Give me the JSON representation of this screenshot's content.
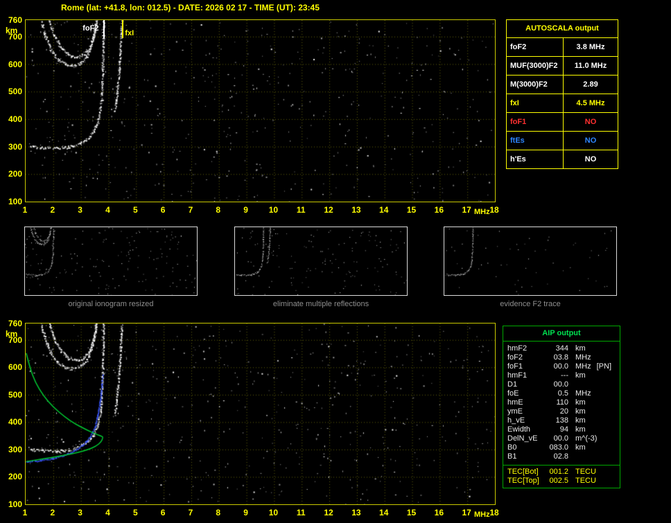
{
  "header": {
    "title": "Rome (lat: +41.8, lon: 012.5) - DATE: 2026 02 17 - TIME (UT): 23:45"
  },
  "autoscala_table": {
    "title": "AUTOSCALA output",
    "border_color": "#ffff00",
    "rows": [
      {
        "label": "foF2",
        "value": "3.8 MHz",
        "color": "#ffffff"
      },
      {
        "label": "MUF(3000)F2",
        "value": "11.0 MHz",
        "color": "#ffffff"
      },
      {
        "label": "M(3000)F2",
        "value": "2.89",
        "color": "#ffffff"
      },
      {
        "label": "fxI",
        "value": "4.5 MHz",
        "color": "#ffff00"
      },
      {
        "label": "foF1",
        "value": "NO",
        "color": "#ff3030"
      },
      {
        "label": "ftEs",
        "value": "NO",
        "color": "#2e86ff"
      },
      {
        "label": "h'Es",
        "value": "NO",
        "color": "#ffffff"
      }
    ]
  },
  "aip_table": {
    "title": "AIP output",
    "border_color": "#00a800",
    "title_color": "#00e050",
    "text_color": "#eaeaea",
    "tec_color": "#ffff00",
    "rows": [
      {
        "label": "hmF2",
        "value": "344",
        "unit": "km",
        "note": ""
      },
      {
        "label": "foF2",
        "value": "03.8",
        "unit": "MHz",
        "note": ""
      },
      {
        "label": "foF1",
        "value": "00.0",
        "unit": "MHz",
        "note": "[PN]"
      },
      {
        "label": "hmF1",
        "value": "---",
        "unit": "km",
        "note": ""
      },
      {
        "label": "D1",
        "value": "00.0",
        "unit": "",
        "note": ""
      },
      {
        "label": "foE",
        "value": "0.5",
        "unit": "MHz",
        "note": ""
      },
      {
        "label": "hmE",
        "value": "110",
        "unit": "km",
        "note": ""
      },
      {
        "label": "ymE",
        "value": "20",
        "unit": "km",
        "note": ""
      },
      {
        "label": "h_vE",
        "value": "138",
        "unit": "km",
        "note": ""
      },
      {
        "label": "Ewidth",
        "value": "94",
        "unit": "km",
        "note": ""
      },
      {
        "label": "DelN_vE",
        "value": "00.0",
        "unit": "m^(-3)",
        "note": ""
      },
      {
        "label": "B0",
        "value": "083.0",
        "unit": "km",
        "note": ""
      },
      {
        "label": "B1",
        "value": "02.8",
        "unit": "",
        "note": ""
      }
    ],
    "tec_rows": [
      {
        "label": "TEC[Bot]",
        "value": "001.2",
        "unit": "TECU"
      },
      {
        "label": "TEC[Top]",
        "value": "002.5",
        "unit": "TECU"
      }
    ]
  },
  "thumbnails": [
    {
      "caption": "original ionogram resized",
      "series_ids": [
        "f2_2hop",
        "f2_2hop_x",
        "f2_o"
      ],
      "noise_points": 180
    },
    {
      "caption": "eliminate multiple reflections",
      "series_ids": [
        "f2_o",
        "f2_x"
      ],
      "noise_points": 150
    },
    {
      "caption": "evidence F2 trace",
      "series_ids": [
        "f2_o"
      ],
      "noise_points": 55
    }
  ],
  "chart_data": [
    {
      "id": "autoscala_ionogram",
      "type": "scatter",
      "xlabel": "MHz",
      "ylabel": "km",
      "xlim": [
        1,
        18
      ],
      "ylim": [
        100,
        760
      ],
      "x_ticks": [
        1,
        2,
        3,
        4,
        5,
        6,
        7,
        8,
        9,
        10,
        11,
        12,
        13,
        14,
        15,
        16,
        17,
        18
      ],
      "y_ticks": [
        100,
        200,
        300,
        400,
        500,
        600,
        700,
        760
      ],
      "grid": true,
      "noise_points": 520,
      "annotations": [
        {
          "label": "foF2",
          "f_mhz": 3.8,
          "color": "#ffffff",
          "align": "left"
        },
        {
          "label": "fxI",
          "f_mhz": 4.5,
          "color": "#ffff00",
          "align": "right"
        }
      ],
      "series": [
        {
          "id": "f2_o",
          "name": "F2 ordinary trace (virtual height)",
          "render": "dots",
          "color": "#ffffff",
          "points": [
            [
              1.15,
              302
            ],
            [
              1.6,
              297
            ],
            [
              2.1,
              295
            ],
            [
              2.55,
              300
            ],
            [
              2.95,
              312
            ],
            [
              3.25,
              330
            ],
            [
              3.45,
              355
            ],
            [
              3.6,
              390
            ],
            [
              3.7,
              440
            ],
            [
              3.75,
              505
            ],
            [
              3.78,
              585
            ],
            [
              3.8,
              680
            ],
            [
              3.81,
              760
            ]
          ]
        },
        {
          "id": "f2_x",
          "name": "F2 extraordinary trace",
          "render": "dots",
          "color": "#ffffff",
          "points": [
            [
              4.22,
              430
            ],
            [
              4.28,
              475
            ],
            [
              4.33,
              525
            ],
            [
              4.38,
              585
            ],
            [
              4.42,
              650
            ],
            [
              4.45,
              715
            ],
            [
              4.47,
              760
            ]
          ]
        },
        {
          "id": "f2_2hop",
          "name": "second reflection trace",
          "render": "dots",
          "color": "#ffffff",
          "points": [
            [
              1.55,
              760
            ],
            [
              1.7,
              705
            ],
            [
              1.9,
              655
            ],
            [
              2.15,
              618
            ],
            [
              2.45,
              600
            ],
            [
              2.75,
              596
            ],
            [
              3.0,
              606
            ],
            [
              3.2,
              628
            ],
            [
              3.35,
              662
            ],
            [
              3.47,
              706
            ],
            [
              3.55,
              760
            ]
          ]
        },
        {
          "id": "f2_2hop_x",
          "name": "second reflection x trace",
          "render": "dots",
          "color": "#ffffff",
          "points": [
            [
              1.85,
              760
            ],
            [
              2.02,
              706
            ],
            [
              2.25,
              662
            ],
            [
              2.55,
              634
            ],
            [
              2.85,
              626
            ],
            [
              3.1,
              636
            ],
            [
              3.3,
              664
            ],
            [
              3.45,
              704
            ],
            [
              3.55,
              760
            ]
          ]
        }
      ]
    },
    {
      "id": "aip_ionogram",
      "type": "scatter",
      "xlabel": "MHz",
      "ylabel": "km",
      "xlim": [
        1,
        18
      ],
      "ylim": [
        100,
        760
      ],
      "x_ticks": [
        1,
        2,
        3,
        4,
        5,
        6,
        7,
        8,
        9,
        10,
        11,
        12,
        13,
        14,
        15,
        16,
        17,
        18
      ],
      "y_ticks": [
        100,
        200,
        300,
        400,
        500,
        600,
        700,
        760
      ],
      "grid": true,
      "noise_points": 520,
      "annotations": [],
      "series": [
        {
          "id": "f2_o",
          "name": "F2 ordinary trace (virtual height)",
          "render": "dots",
          "color": "#ffffff",
          "points": [
            [
              1.15,
              302
            ],
            [
              1.6,
              297
            ],
            [
              2.1,
              295
            ],
            [
              2.55,
              300
            ],
            [
              2.95,
              312
            ],
            [
              3.25,
              330
            ],
            [
              3.45,
              355
            ],
            [
              3.6,
              390
            ],
            [
              3.7,
              440
            ],
            [
              3.75,
              505
            ],
            [
              3.78,
              585
            ],
            [
              3.8,
              680
            ],
            [
              3.81,
              760
            ]
          ]
        },
        {
          "id": "f2_x",
          "name": "F2 extraordinary trace",
          "render": "dots",
          "color": "#ffffff",
          "points": [
            [
              4.22,
              430
            ],
            [
              4.28,
              475
            ],
            [
              4.33,
              525
            ],
            [
              4.38,
              585
            ],
            [
              4.42,
              650
            ],
            [
              4.45,
              715
            ],
            [
              4.47,
              760
            ]
          ]
        },
        {
          "id": "f2_2hop",
          "name": "second reflection trace",
          "render": "dots",
          "color": "#ffffff",
          "points": [
            [
              1.55,
              760
            ],
            [
              1.7,
              705
            ],
            [
              1.9,
              655
            ],
            [
              2.15,
              618
            ],
            [
              2.45,
              600
            ],
            [
              2.75,
              596
            ],
            [
              3.0,
              606
            ],
            [
              3.2,
              628
            ],
            [
              3.35,
              662
            ],
            [
              3.47,
              706
            ],
            [
              3.55,
              760
            ]
          ]
        },
        {
          "id": "f2_2hop_x",
          "name": "second reflection x trace",
          "render": "dots",
          "color": "#ffffff",
          "points": [
            [
              1.85,
              760
            ],
            [
              2.02,
              706
            ],
            [
              2.25,
              662
            ],
            [
              2.55,
              634
            ],
            [
              2.85,
              626
            ],
            [
              3.1,
              636
            ],
            [
              3.3,
              664
            ],
            [
              3.45,
              704
            ],
            [
              3.55,
              760
            ]
          ]
        },
        {
          "id": "fitted",
          "name": "fitted F2 trace (model)",
          "render": "dots",
          "color": "#3a57ff",
          "points": [
            [
              1.0,
              257
            ],
            [
              1.5,
              261
            ],
            [
              2.0,
              270
            ],
            [
              2.5,
              285
            ],
            [
              2.85,
              303
            ],
            [
              3.15,
              326
            ],
            [
              3.35,
              352
            ],
            [
              3.5,
              385
            ],
            [
              3.6,
              425
            ],
            [
              3.68,
              475
            ],
            [
              3.74,
              530
            ],
            [
              3.77,
              575
            ]
          ]
        },
        {
          "id": "profile",
          "name": "electron density profile (real height)",
          "render": "line",
          "color": "#00cc33",
          "points": [
            [
              1.02,
              652
            ],
            [
              1.15,
              600
            ],
            [
              1.35,
              545
            ],
            [
              1.65,
              495
            ],
            [
              2.0,
              455
            ],
            [
              2.4,
              420
            ],
            [
              2.8,
              393
            ],
            [
              3.2,
              372
            ],
            [
              3.55,
              356
            ],
            [
              3.78,
              347
            ],
            [
              3.8,
              344
            ],
            [
              3.74,
              328
            ],
            [
              3.55,
              312
            ],
            [
              3.25,
              299
            ],
            [
              2.85,
              288
            ],
            [
              2.4,
              279
            ],
            [
              1.9,
              270
            ],
            [
              1.4,
              262
            ],
            [
              1.02,
              256
            ]
          ]
        }
      ]
    }
  ]
}
